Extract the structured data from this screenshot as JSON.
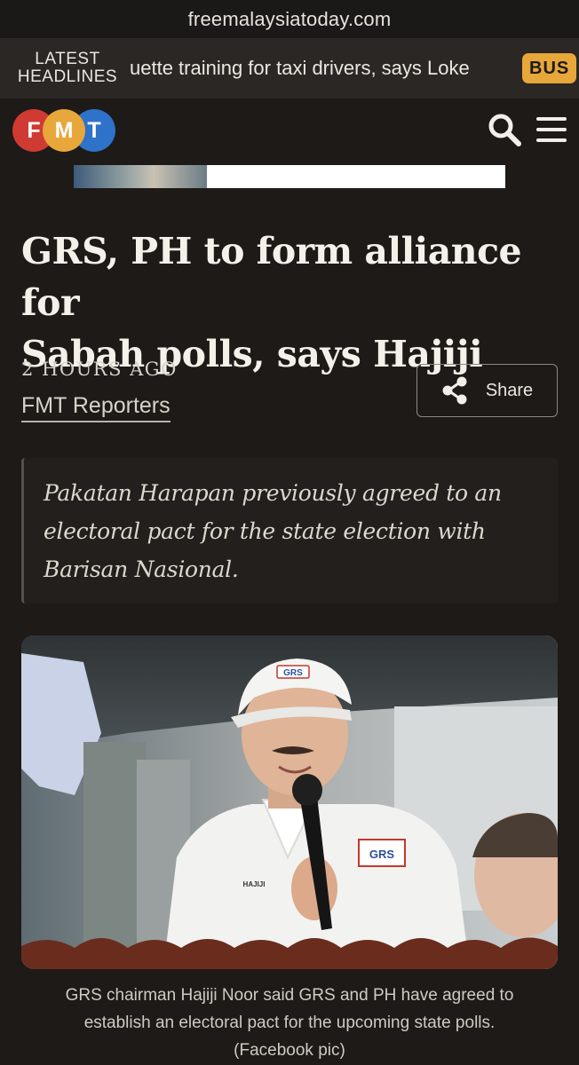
{
  "browser": {
    "url": "freemalaysiatoday.com"
  },
  "ticker": {
    "label_line1": "LATEST",
    "label_line2": "HEADLINES",
    "text": "uette training for taxi drivers, says Loke",
    "badge": "BUS"
  },
  "header": {
    "logo_letters": [
      "F",
      "M",
      "T"
    ],
    "colors": {
      "f": "#cf3a33",
      "m": "#e8a73a",
      "t": "#2e72c9"
    },
    "search_icon": "search-icon",
    "menu_icon": "hamburger-menu-icon"
  },
  "article": {
    "headline_line1": "GRS, PH to form alliance for",
    "headline_line2": "Sabah polls, says Hajiji",
    "time": "2 HOURS AGO",
    "author": "FMT Reporters",
    "share_label": "Share",
    "summary_line1": "Pakatan Harapan previously agreed to an",
    "summary_line2": "electoral pact for the state election with",
    "summary_line3": "Barisan Nasional.",
    "photo_cap_badge": "GRS",
    "photo_shirt_badge": "GRS",
    "photo_name_tag": "HAJIJI",
    "caption_line1": "GRS chairman Hajiji Noor said GRS and PH have agreed to",
    "caption_line2": "establish an electoral pact for the upcoming state polls.",
    "caption_line3": "(Facebook pic)"
  }
}
